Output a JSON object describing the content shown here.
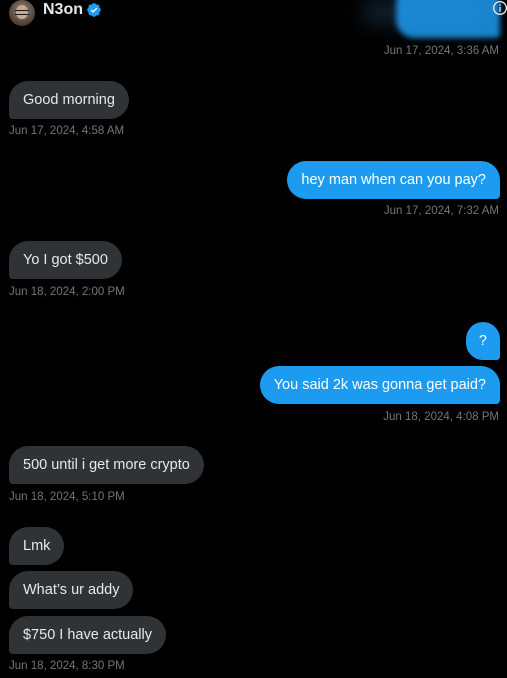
{
  "contact": {
    "name": "N3on"
  },
  "colors": {
    "background": "#000000",
    "incoming_bubble": "#2f3336",
    "outgoing_bubble": "#1d9bf0",
    "timestamp": "#71767b",
    "text": "#e7e9ea"
  },
  "icons": {
    "verified": "verified-badge-icon",
    "info": "info-icon",
    "avatar": "avatar"
  },
  "messages": [
    {
      "text": "Good morning",
      "dir": "in"
    },
    {
      "text": "hey man when can you pay?",
      "dir": "out"
    },
    {
      "text": "Yo I got $500",
      "dir": "in"
    },
    {
      "text": "?",
      "dir": "out"
    },
    {
      "text": "You said 2k was gonna get paid?",
      "dir": "out"
    },
    {
      "text": "500 until i get more crypto",
      "dir": "in"
    },
    {
      "text": "Lmk",
      "dir": "in"
    },
    {
      "text": "What’s ur addy",
      "dir": "in"
    },
    {
      "text": "$750 I have actually",
      "dir": "in"
    }
  ],
  "timestamps": [
    "Jun 17, 2024, 3:36 AM",
    "Jun 17, 2024, 4:58 AM",
    "Jun 17, 2024, 7:32 AM",
    "Jun 18, 2024, 2:00 PM",
    "Jun 18, 2024, 4:08 PM",
    "Jun 18, 2024, 5:10 PM",
    "Jun 18, 2024, 8:30 PM"
  ]
}
